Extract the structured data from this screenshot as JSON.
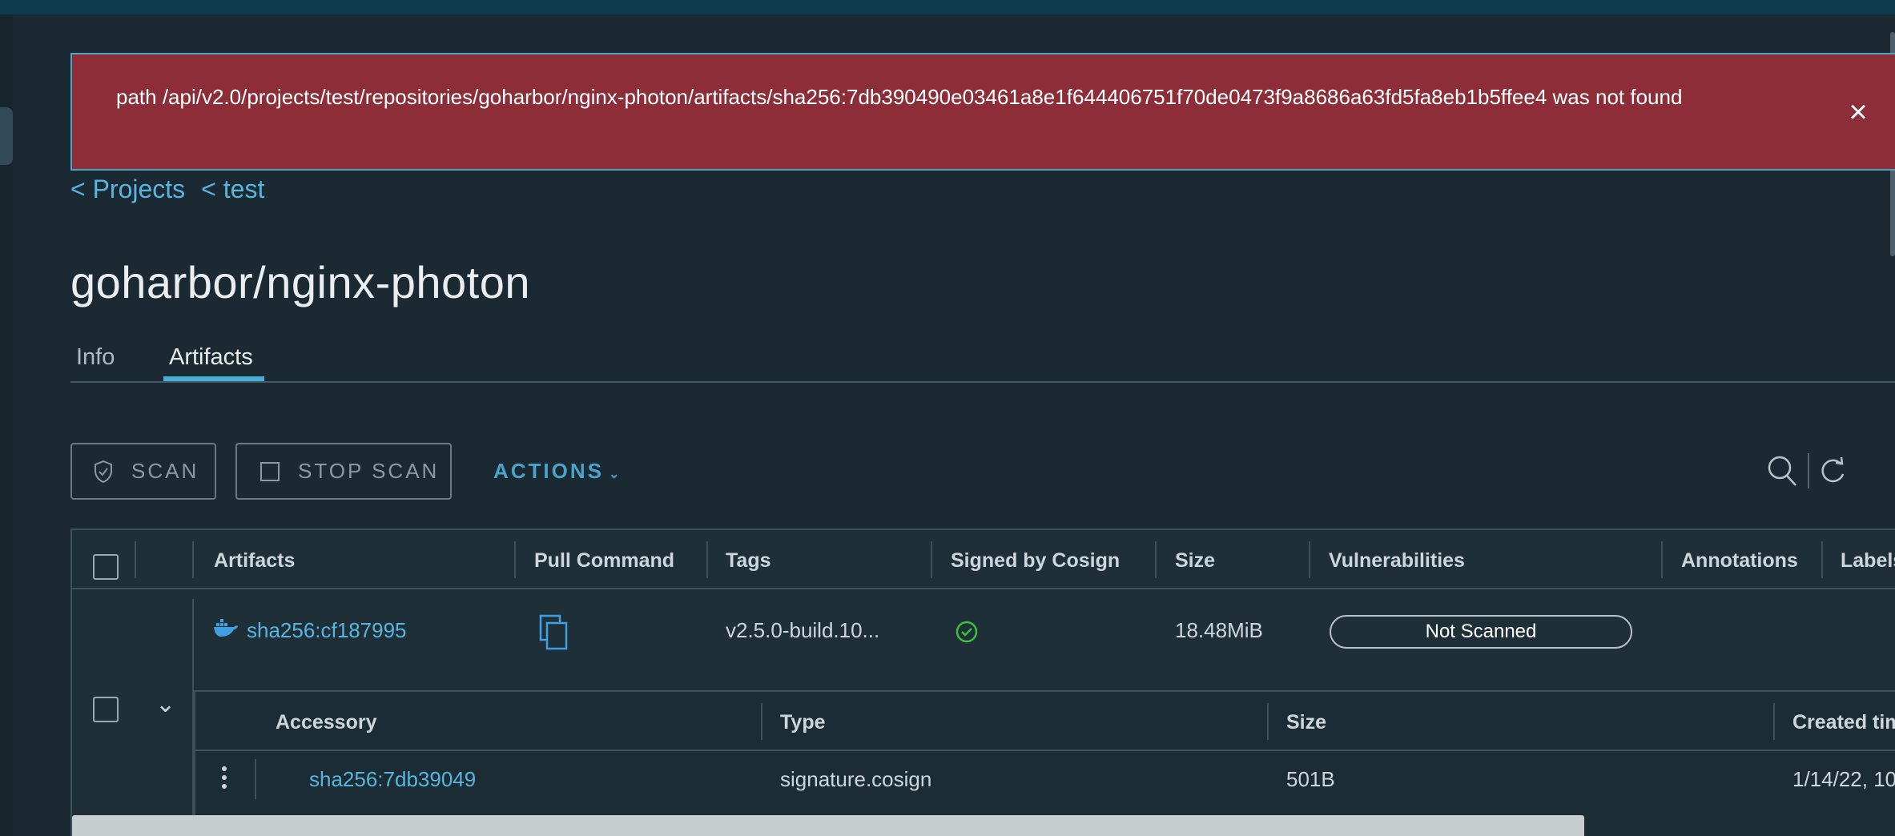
{
  "alert": {
    "message": "path /api/v2.0/projects/test/repositories/goharbor/nginx-photon/artifacts/sha256:7db390490e03461a8e1f644406751f70de0473f9a8686a63fd5fa8eb1b5ffee4 was not found",
    "close": "×"
  },
  "breadcrumb": {
    "projects": "< Projects",
    "project": "< test"
  },
  "title": "goharbor/nginx-photon",
  "tabs": {
    "info": "Info",
    "artifacts": "Artifacts"
  },
  "toolbar": {
    "scan": "SCAN",
    "stop_scan": "STOP SCAN",
    "actions": "ACTIONS"
  },
  "table": {
    "headers": {
      "artifacts": "Artifacts",
      "pull_command": "Pull Command",
      "tags": "Tags",
      "signed": "Signed by Cosign",
      "size": "Size",
      "vulnerabilities": "Vulnerabilities",
      "annotations": "Annotations",
      "labels": "Labels"
    },
    "row": {
      "digest": "sha256:cf187995",
      "tags": "v2.5.0-build.10...",
      "size": "18.48MiB",
      "vulnerabilities": "Not Scanned"
    }
  },
  "accessory": {
    "headers": {
      "accessory": "Accessory",
      "type": "Type",
      "size": "Size",
      "created": "Created time"
    },
    "row": {
      "digest": "sha256:7db39049",
      "type": "signature.cosign",
      "size": "501B",
      "created": "1/14/22, 10"
    }
  },
  "colors": {
    "accent": "#49afd9",
    "alert": "#8c2d37",
    "success": "#3fbf3f"
  }
}
